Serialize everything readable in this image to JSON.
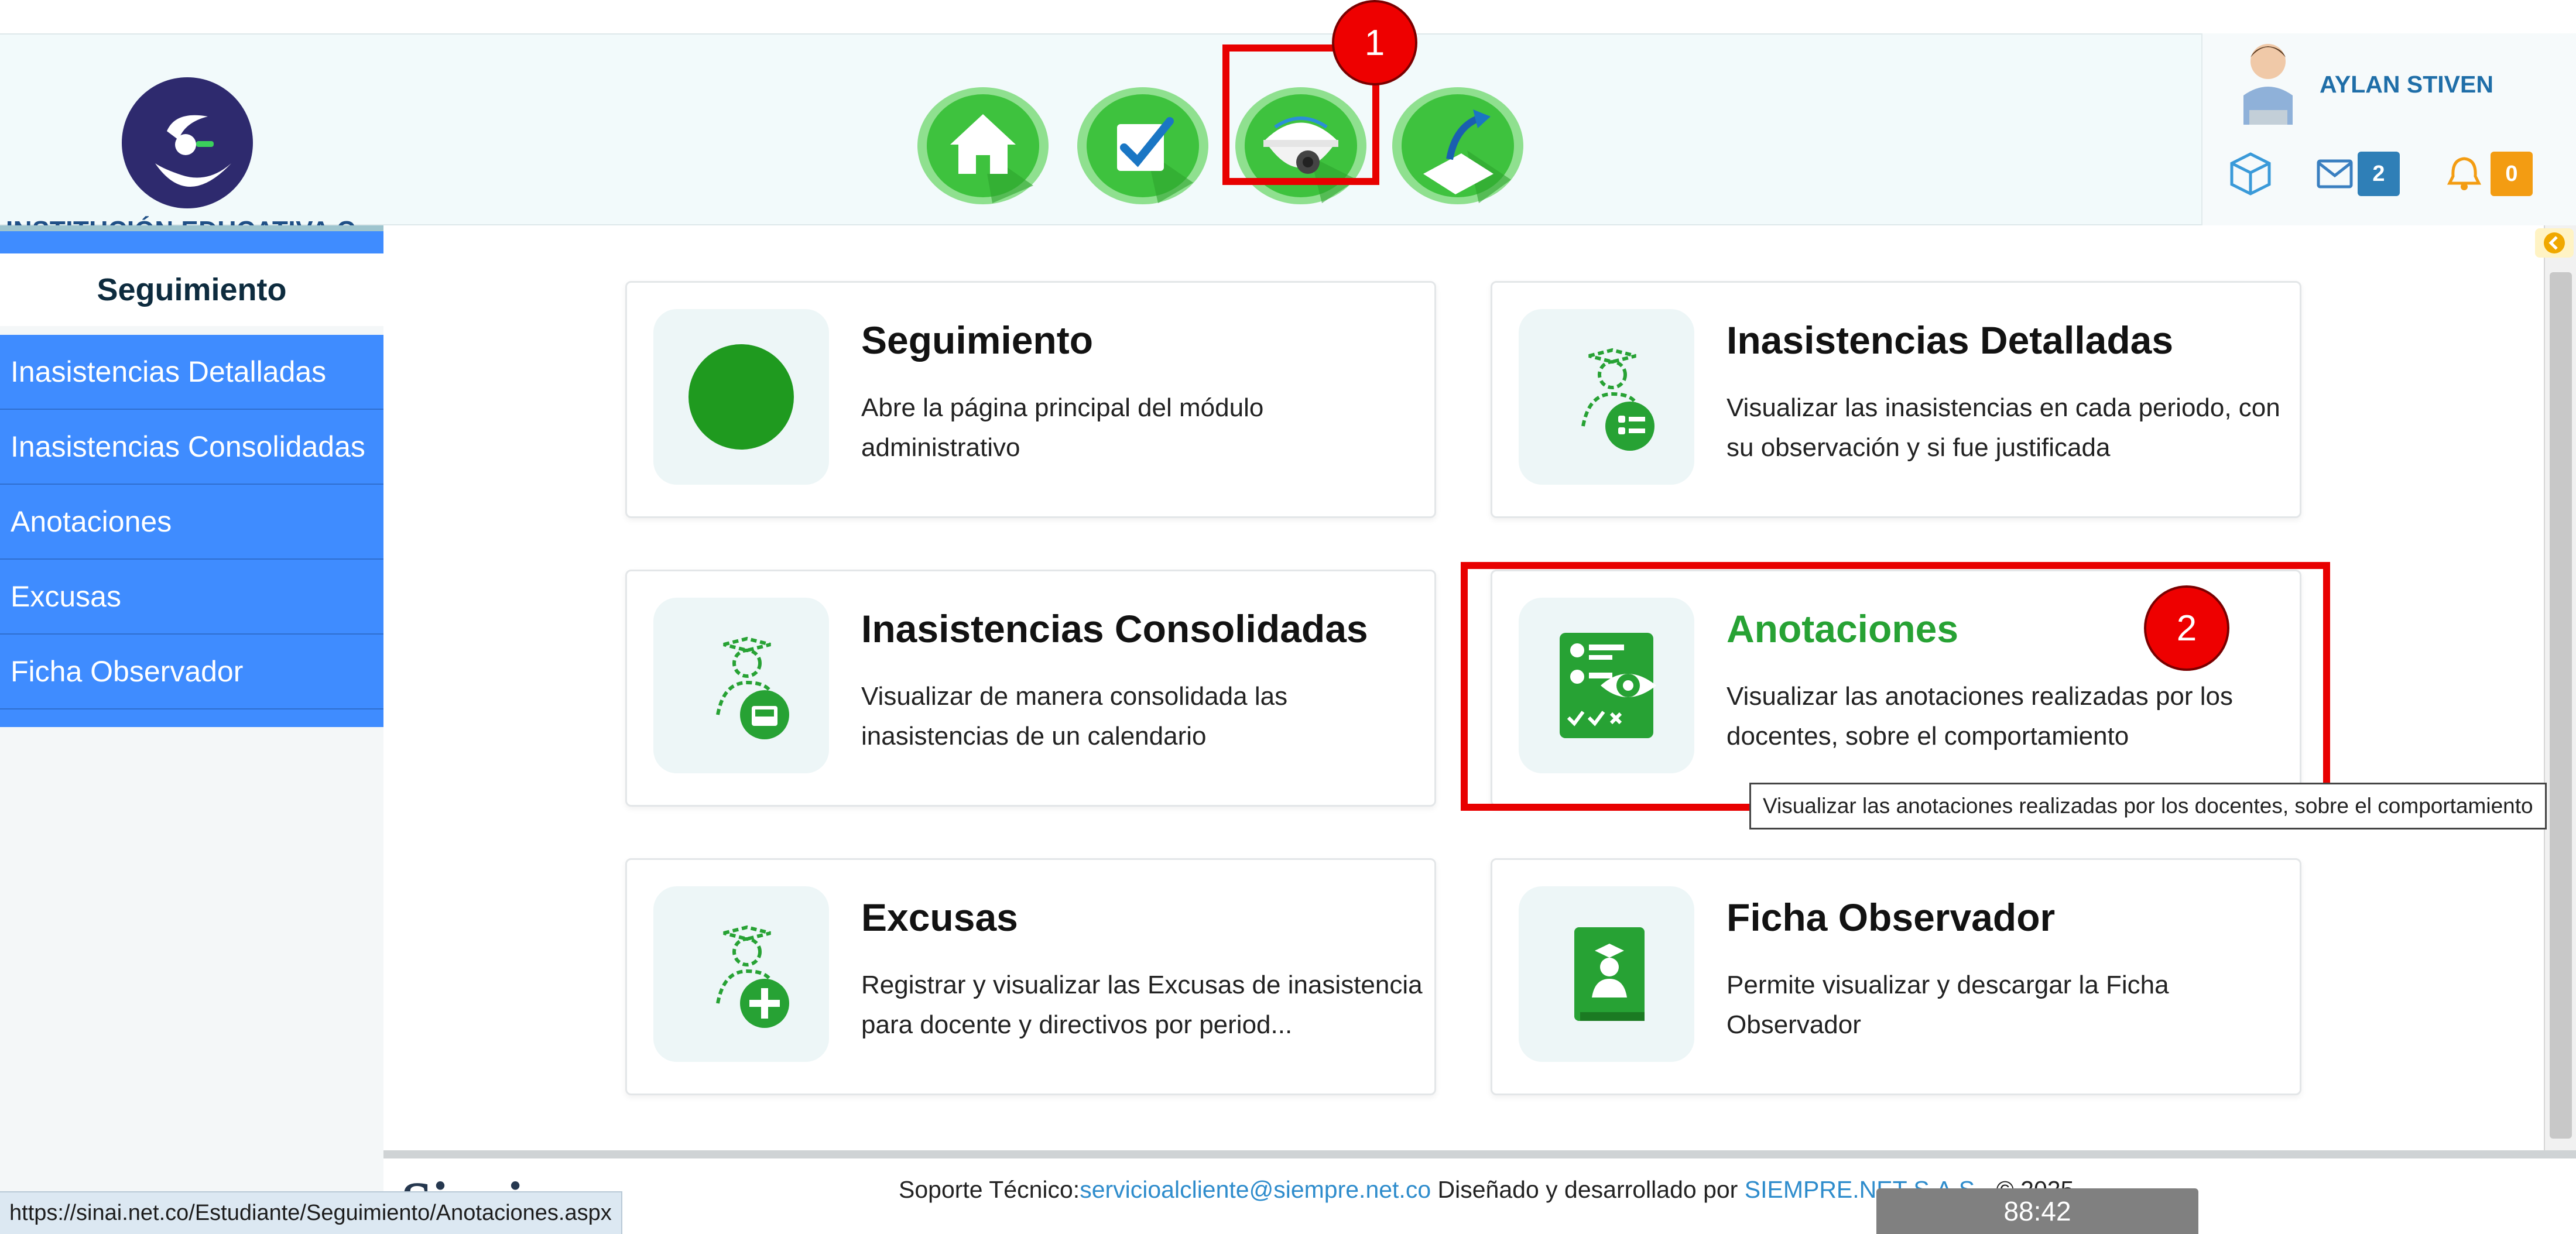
{
  "header": {
    "school_name": "INSTITUCIÓN EDUCATIVA C...",
    "nav": [
      {
        "name": "home-icon"
      },
      {
        "name": "check-icon"
      },
      {
        "name": "camera-icon"
      },
      {
        "name": "pen-icon"
      }
    ],
    "user": {
      "name": "AYLAN STIVEN",
      "messages_count": "2",
      "notifications_count": "0"
    }
  },
  "sidebar": {
    "title": "Seguimiento",
    "items": [
      {
        "label": "Inasistencias Detalladas"
      },
      {
        "label": "Inasistencias Consolidadas"
      },
      {
        "label": "Anotaciones"
      },
      {
        "label": "Excusas"
      },
      {
        "label": "Ficha Observador"
      }
    ]
  },
  "cards": [
    {
      "title": "Seguimiento",
      "description": "Abre la página principal del módulo administrativo",
      "icon": "green-circle-icon"
    },
    {
      "title": "Inasistencias Detalladas",
      "description": "Visualizar las inasistencias en cada periodo, con su observación y si fue justificada",
      "icon": "student-list-icon"
    },
    {
      "title": "Inasistencias Consolidadas",
      "description": "Visualizar de manera consolidada las inasistencias de un calendario",
      "icon": "student-inbox-icon"
    },
    {
      "title": "Anotaciones",
      "description": "Visualizar las anotaciones realizadas por los docentes, sobre el comportamiento",
      "icon": "observation-sheet-icon"
    },
    {
      "title": "Excusas",
      "description": "Registrar y visualizar las Excusas de inasistencia para docente y directivos por period...",
      "icon": "student-add-icon"
    },
    {
      "title": "Ficha Observador",
      "description": "Permite visualizar y descargar la Ficha Observador",
      "icon": "student-book-icon"
    }
  ],
  "annotations": {
    "first": "1",
    "second": "2"
  },
  "tooltip": "Visualizar las anotaciones realizadas por los docentes, sobre el comportamiento",
  "footer": {
    "logo_text": "Sinai",
    "support_label": "Soporte Técnico:",
    "support_email": "servicioalcliente@siempre.net.co",
    "designed_label": " Diseñado y desarrollado por ",
    "company": "SIEMPRE.NET S.A.S",
    "copyright": " -  © 2025"
  },
  "status_url": "https://sinai.net.co/Estudiante/Seguimiento/Anotaciones.aspx",
  "timer": "88:42",
  "colors": {
    "primary_green": "#27a234",
    "sidebar_blue": "#3f8cff",
    "annotation_red": "#e80000"
  }
}
